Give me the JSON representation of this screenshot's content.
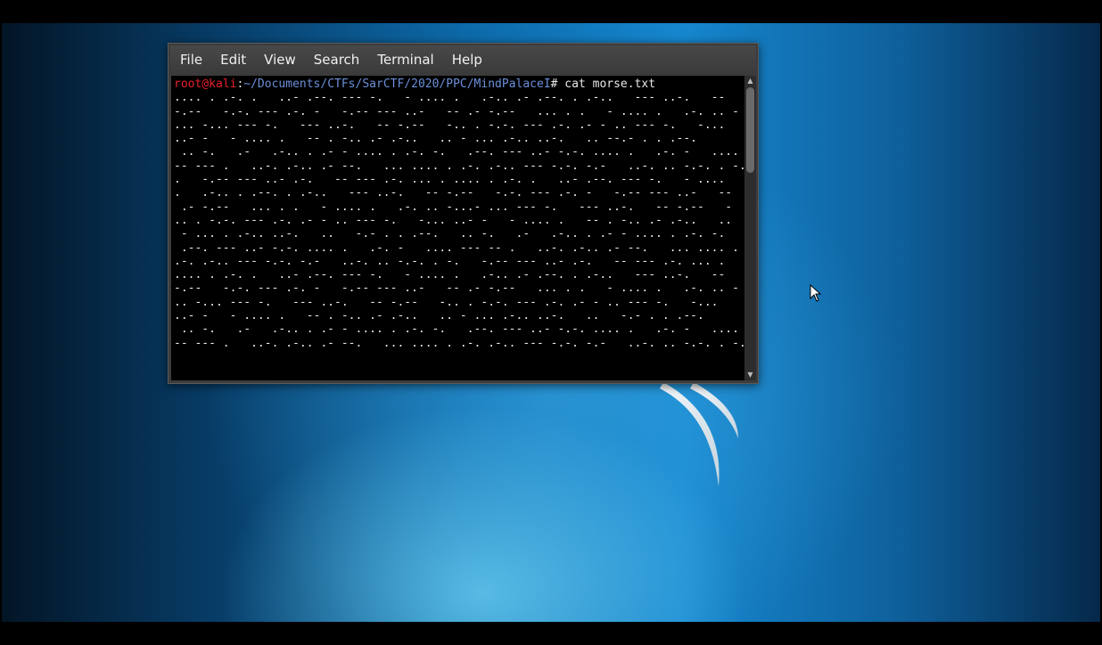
{
  "desktop": {
    "theme": "kali-blue",
    "accent": "#1687cf"
  },
  "terminal": {
    "menu": [
      "File",
      "Edit",
      "View",
      "Search",
      "Terminal",
      "Help"
    ],
    "prompt": {
      "user_host": "root@kali",
      "separator": ":",
      "path": "~/Documents/CTFs/SarCTF/2020/PPC/MindPalaceI",
      "symbol": "#",
      "command": " cat morse.txt"
    },
    "output_lines": [
      ".... . .-. .   ..- .--. --- -.   - .... .   .-.. .- .--. . .-..   --- ..-.   --",
      "-.--   -.-. --- .-. -   -.-- --- ..-   -- .- -.--   ... . .   - .... .   .-. .. -",
      "... -... --- -.   --- ..-.   -- -.--   -.. . -.-. --- .-. .- - .. --- -.   -...",
      "..- -   - .... .   -- . -.. .- .-..   .. - ... .-.. ..-.   .. --.- . . .--.",
      " .. -.   .-   .-.. . .- - .... . .-. -.   .--. --- ..- -.-. .... .   .-. -   .... -",
      "-- --- .   ..-. .-.. .- --.   ... .... . .-. .-.. --- -.-. -.-   ..-. .. -.-. . -.",
      ".   -.-- --- ..- .-.   -- --- .-. ... . .... . .-. .   ..- .--. --- -.   - ....",
      ".   .-.. . .--. . .-..   --- ..-.   -- -.--   -.-. --- .-. -   -.-- --- ..-   --",
      " .- -.--   ... . .   - .... .   .-. .. -...- ... --- -.   --- ..-.   -- -.--   -",
      ".. . -.-. --- .-. .- - .. --- -.   -... ..- -   - .... .   -- . -.. .- .-..   ..",
      " - ... . .-.. ..-.   ..   -.- . . .--.   .. -.   .-   .-.. . .- - .... . .-. -.",
      " .--. --- ..- -.-. .... .   .-. -   .... --- -- .   ..-. .-.. .- --.   ... .... .",
      ".-. .-.. --- -.-. -.-   ..-. .. -.-. . -.   -.-- --- ..- .-.   -- --- .-. ... .",
      ".... . .-. .   ..- .--. --- -.   - .... .   .-.. .- .--. . .-..   --- ..-.   --",
      "-.--   -.-. --- .-. -   -.-- --- ..-   -- .- -.--   ... . .   - .... .   .-. .. -",
      ".. -... --- -.   --- ..-.   -- -.--   -.. . -.-. --- .-. .- - .. --- -.   -...",
      "..- -   - .... .   -- . -.. .- .-..   .. - ... .-.. ..-.   ..   -.- . . .--.",
      " .. -.   .-   .-.. . .- - .... . .-. -.   .--. --- ..- -.-. .... .   .-. -   .... -",
      "-- --- .   ..-. .-.. .- --.   ... .... . .-. .-.. --- -.-. -.-   ..-. .. -.-. . -. ."
    ]
  }
}
